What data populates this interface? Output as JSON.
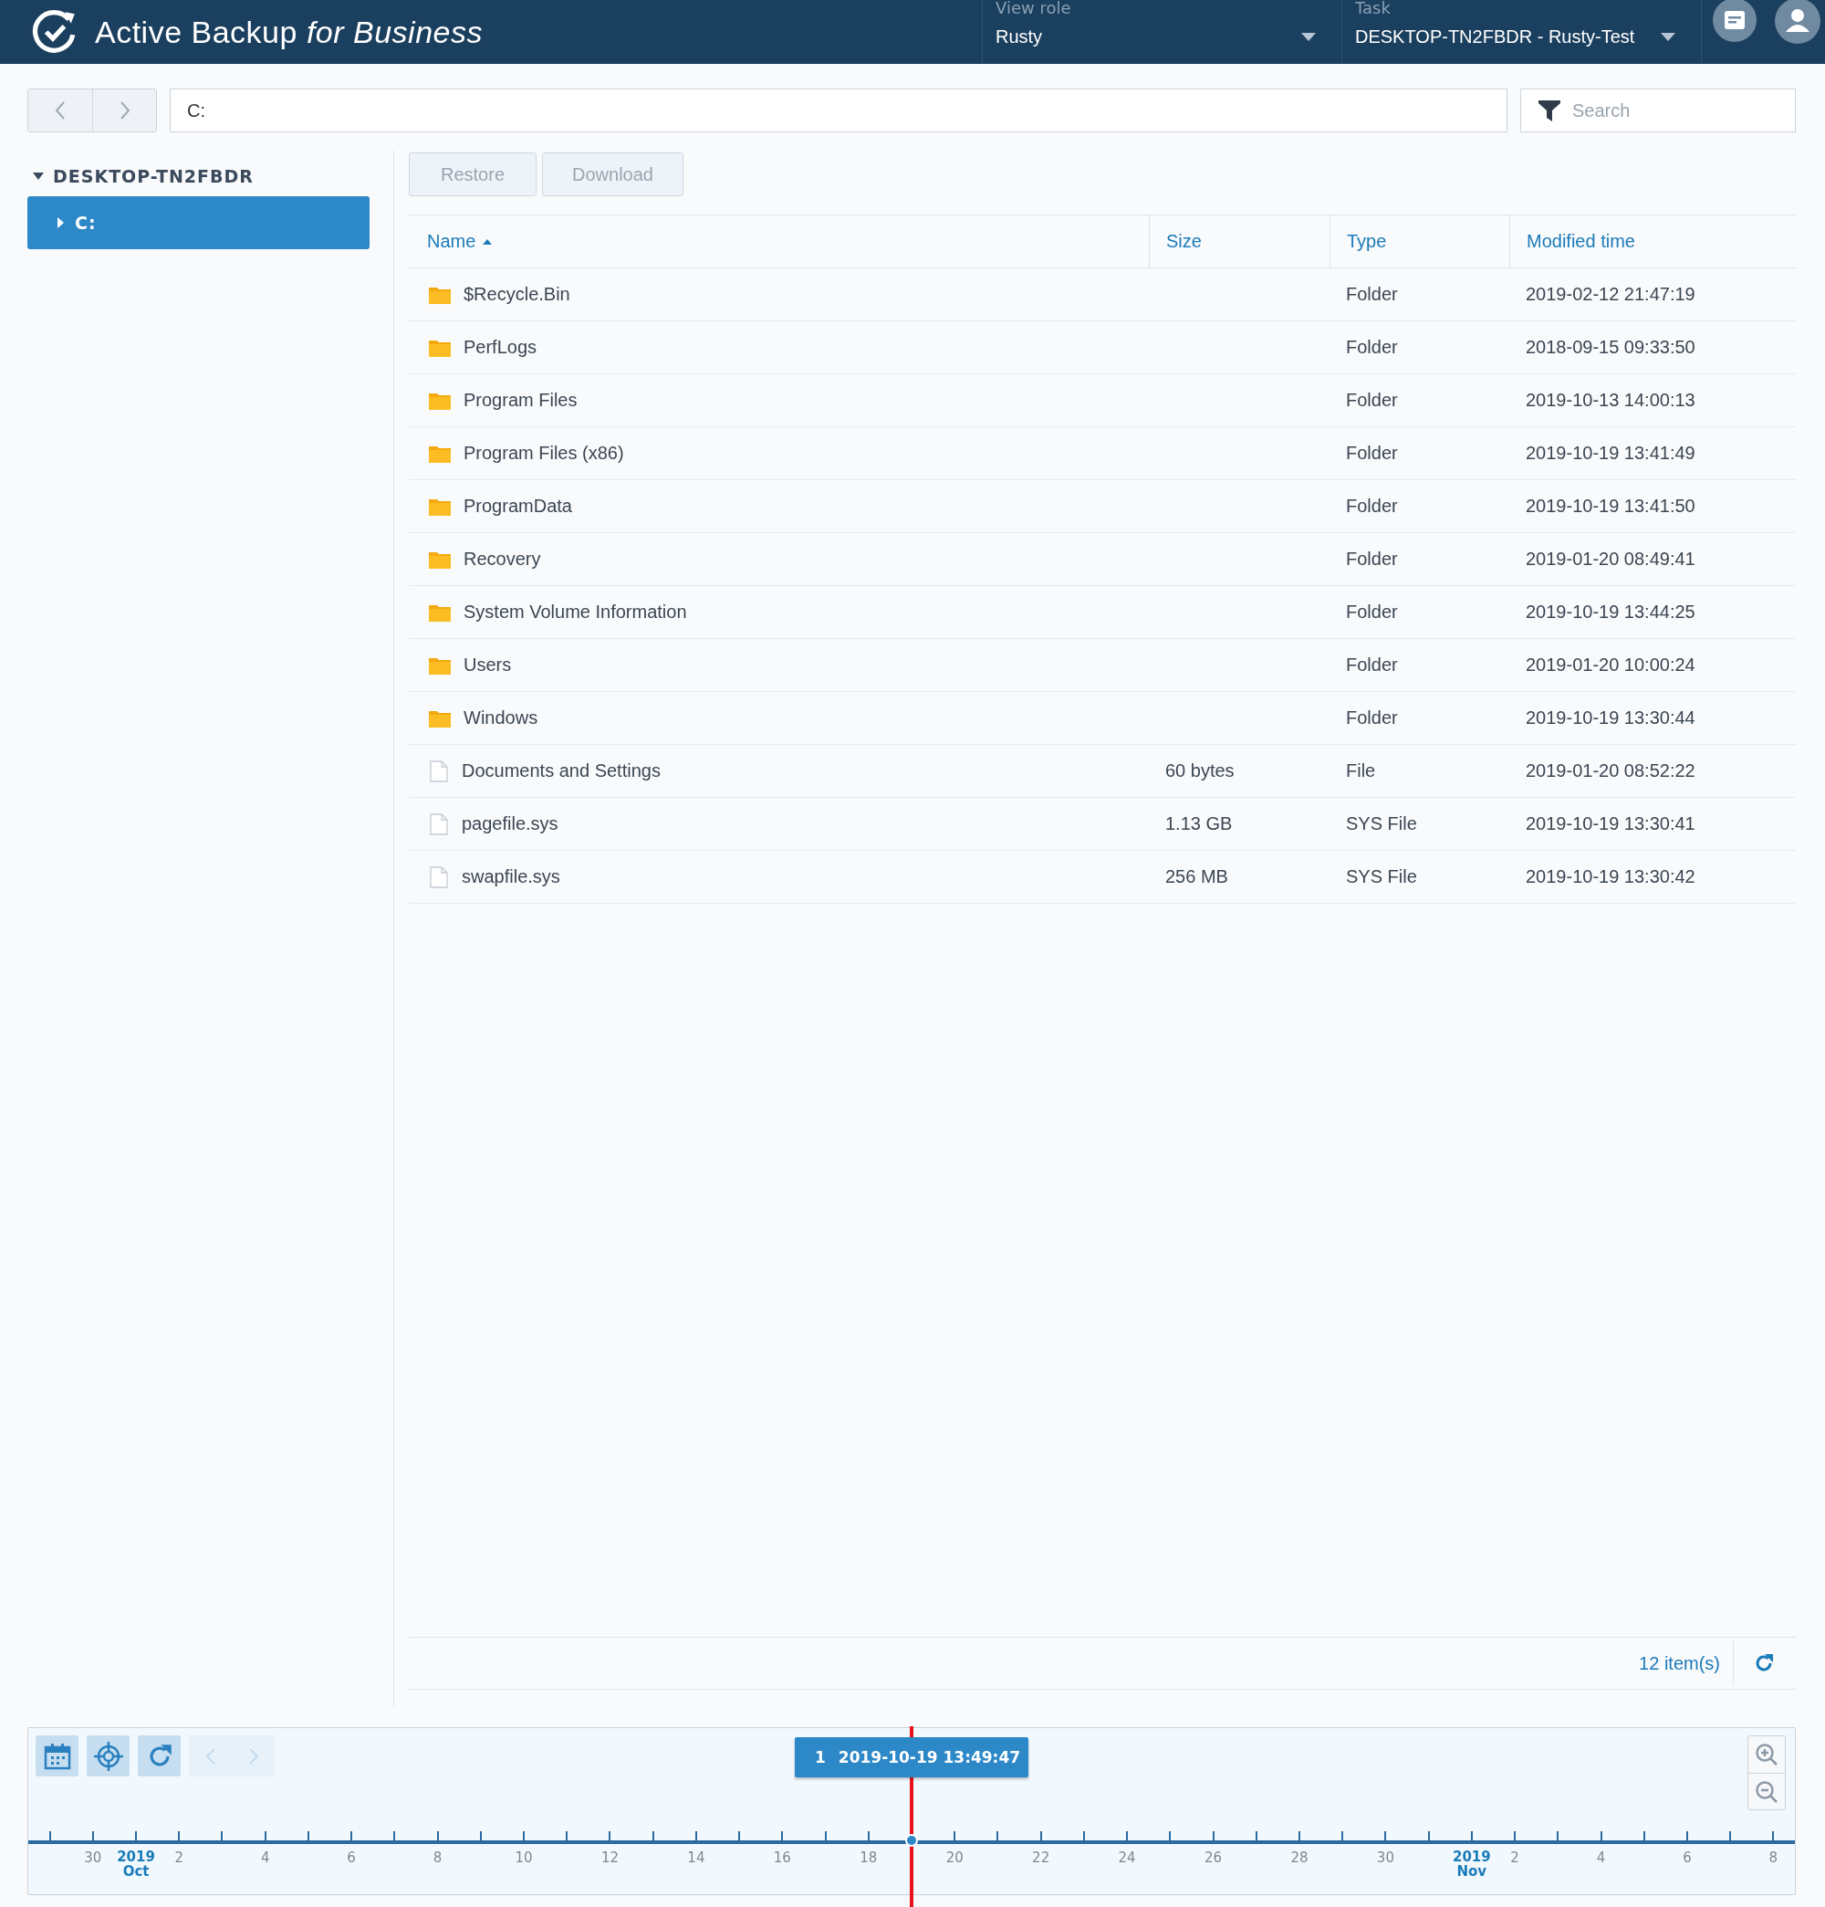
{
  "header": {
    "title": "Active Backup *for Business*",
    "view_role": {
      "label": "View role",
      "value": "Rusty"
    },
    "task": {
      "label": "Task",
      "value": "DESKTOP-TN2FBDR - Rusty-Test"
    }
  },
  "nav": {
    "back_disabled": true,
    "forward_disabled": true,
    "path": "C:",
    "search": {
      "placeholder": "Search"
    }
  },
  "tree": [
    {
      "label": "DESKTOP-TN2FBDR",
      "expanded": true,
      "selected": false,
      "children": [
        {
          "label": "C:",
          "expanded": false,
          "selected": true
        }
      ]
    }
  ],
  "toolbar": [
    {
      "label": "Restore",
      "disabled": true
    },
    {
      "label": "Download",
      "disabled": true
    }
  ],
  "table": {
    "columns": [
      {
        "label": "Name",
        "sorted": true
      },
      {
        "label": "Size",
        "sorted": false
      },
      {
        "label": "Type",
        "sorted": false
      },
      {
        "label": "Modified time",
        "sorted": false
      }
    ],
    "rows": [
      {
        "kind": "folder",
        "name": "$Recycle.Bin",
        "type": "Folder",
        "modified": "2019-02-12 21:47:19"
      },
      {
        "kind": "folder",
        "name": "PerfLogs",
        "type": "Folder",
        "modified": "2018-09-15 09:33:50"
      },
      {
        "kind": "folder",
        "name": "Program Files",
        "type": "Folder",
        "modified": "2019-10-13 14:00:13"
      },
      {
        "kind": "folder",
        "name": "Program Files (x86)",
        "type": "Folder",
        "modified": "2019-10-19 13:41:49"
      },
      {
        "kind": "folder",
        "name": "ProgramData",
        "type": "Folder",
        "modified": "2019-10-19 13:41:50"
      },
      {
        "kind": "folder",
        "name": "Recovery",
        "type": "Folder",
        "modified": "2019-01-20 08:49:41"
      },
      {
        "kind": "folder",
        "name": "System Volume Information",
        "type": "Folder",
        "modified": "2019-10-19 13:44:25"
      },
      {
        "kind": "folder",
        "name": "Users",
        "type": "Folder",
        "modified": "2019-01-20 10:00:24"
      },
      {
        "kind": "folder",
        "name": "Windows",
        "type": "Folder",
        "modified": "2019-10-19 13:30:44"
      },
      {
        "kind": "file",
        "name": "Documents and Settings",
        "size": "60 bytes",
        "type": "File",
        "modified": "2019-01-20 08:52:22"
      },
      {
        "kind": "file",
        "name": "pagefile.sys",
        "size": "1.13 GB",
        "type": "SYS File",
        "modified": "2019-10-19 13:30:41"
      },
      {
        "kind": "file",
        "name": "swapfile.sys",
        "size": "256 MB",
        "type": "SYS File",
        "modified": "2019-10-19 13:30:42"
      }
    ],
    "item_count": "12 item(s)"
  },
  "timeline": {
    "prev_disabled": true,
    "next_disabled": true,
    "marker": {
      "count": "1",
      "time": "2019-10-19 13:49:47"
    },
    "axis_labels": [
      {
        "kind": "day",
        "text": "30"
      },
      {
        "kind": "month",
        "year": "2019",
        "month": "Oct"
      },
      {
        "kind": "day",
        "text": "2"
      },
      {
        "kind": "day",
        "text": "4"
      },
      {
        "kind": "day",
        "text": "6"
      },
      {
        "kind": "day",
        "text": "8"
      },
      {
        "kind": "day",
        "text": "10"
      },
      {
        "kind": "day",
        "text": "12"
      },
      {
        "kind": "day",
        "text": "14"
      },
      {
        "kind": "day",
        "text": "16"
      },
      {
        "kind": "day",
        "text": "18"
      },
      {
        "kind": "day",
        "text": "20"
      },
      {
        "kind": "day",
        "text": "22"
      },
      {
        "kind": "day",
        "text": "24"
      },
      {
        "kind": "day",
        "text": "26"
      },
      {
        "kind": "day",
        "text": "28"
      },
      {
        "kind": "day",
        "text": "30"
      },
      {
        "kind": "month",
        "year": "2019",
        "month": "Nov"
      },
      {
        "kind": "day",
        "text": "2"
      },
      {
        "kind": "day",
        "text": "4"
      },
      {
        "kind": "day",
        "text": "6"
      },
      {
        "kind": "day",
        "text": "8"
      }
    ]
  }
}
